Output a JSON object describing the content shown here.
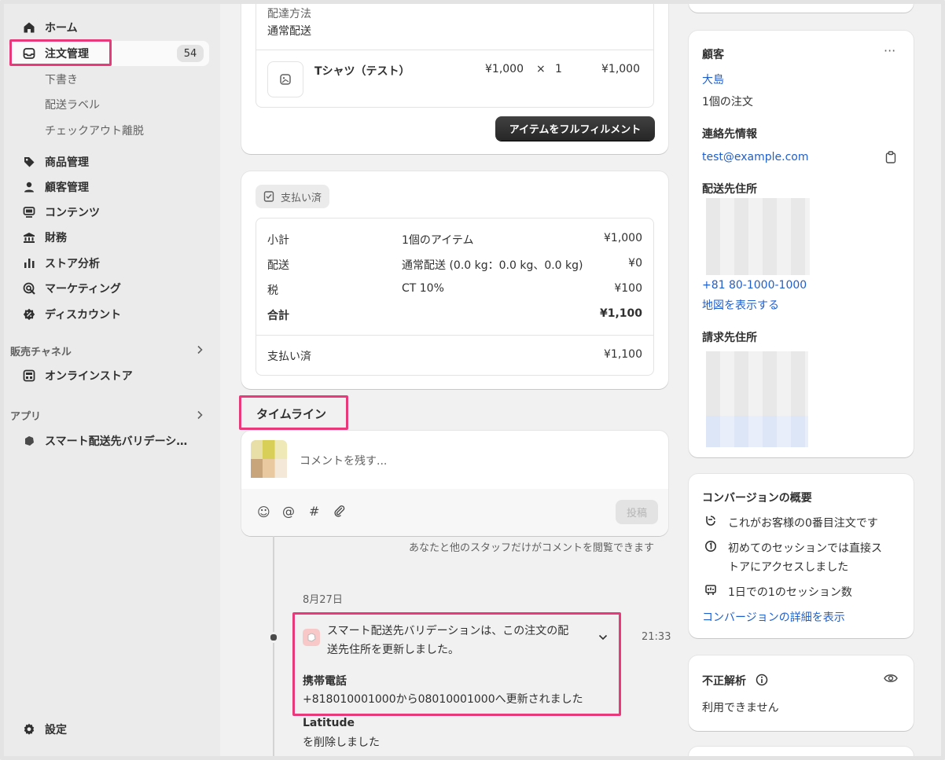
{
  "sidebar": {
    "home": "ホーム",
    "orders": "注文管理",
    "orders_count": "54",
    "drafts": "下書き",
    "shipping_labels": "配送ラベル",
    "abandoned_checkouts": "チェックアウト離脱",
    "products": "商品管理",
    "customers": "顧客管理",
    "content": "コンテンツ",
    "finance": "財務",
    "analytics": "ストア分析",
    "marketing": "マーケティング",
    "discounts": "ディスカウント",
    "sales_channels": "販売チャネル",
    "online_store": "オンラインストア",
    "apps": "アプリ",
    "app_smart": "スマート配送先バリデーシ…",
    "settings": "設定"
  },
  "fulfillment": {
    "shipping_method_label": "配達方法",
    "shipping_method_value": "通常配送",
    "item_name": "Tシャツ（テスト）",
    "item_price": "¥1,000",
    "item_times": "×",
    "item_qty": "1",
    "item_total": "¥1,000",
    "fulfill_button": "アイテムをフルフィルメント"
  },
  "payment": {
    "status_badge": "支払い済",
    "rows": [
      {
        "label": "小計",
        "desc": "1個のアイテム",
        "amount": "¥1,000"
      },
      {
        "label": "配送",
        "desc": "通常配送 (0.0 kg：0.0 kg、0.0 kg)",
        "amount": "¥0"
      },
      {
        "label": "税",
        "desc": "CT 10%",
        "amount": "¥100"
      }
    ],
    "total_label": "合計",
    "total_amount": "¥1,100",
    "paid_label": "支払い済",
    "paid_amount": "¥1,100"
  },
  "timeline": {
    "title": "タイムライン",
    "comment_placeholder": "コメントを残す...",
    "post_button": "投稿",
    "note": "あなたと他のスタッフだけがコメントを閲覧できます",
    "date": "8月27日",
    "event_text_1": "スマート配送先バリデーションは、この注文の配",
    "event_text_2": "送先住所を更新しました。",
    "event_time": "21:33",
    "detail_title": "携帯電話",
    "detail_text": "+818010001000から08010001000へ更新されました",
    "latitude_title": "Latitude",
    "latitude_text": "を削除しました"
  },
  "customer": {
    "title": "顧客",
    "more": "···",
    "name": "大島",
    "orders": "1個の注文",
    "contact_title": "連絡先情報",
    "email": "test@example.com",
    "shipping_title": "配送先住所",
    "phone": "+81 80-1000-1000",
    "map_link": "地図を表示する",
    "billing_title": "請求先住所"
  },
  "conversion": {
    "title": "コンバージョンの概要",
    "line1": "これがお客様の0番目注文です",
    "line2a": "初めてのセッションでは直接ス",
    "line2b": "トアにアクセスしました",
    "line3": "1日での1のセッション数",
    "details_link": "コンバージョンの詳細を表示"
  },
  "fraud": {
    "title": "不正解析",
    "status": "利用できません"
  },
  "colors": {
    "highlight": "#e83a7b",
    "link": "#1f5fcc"
  }
}
